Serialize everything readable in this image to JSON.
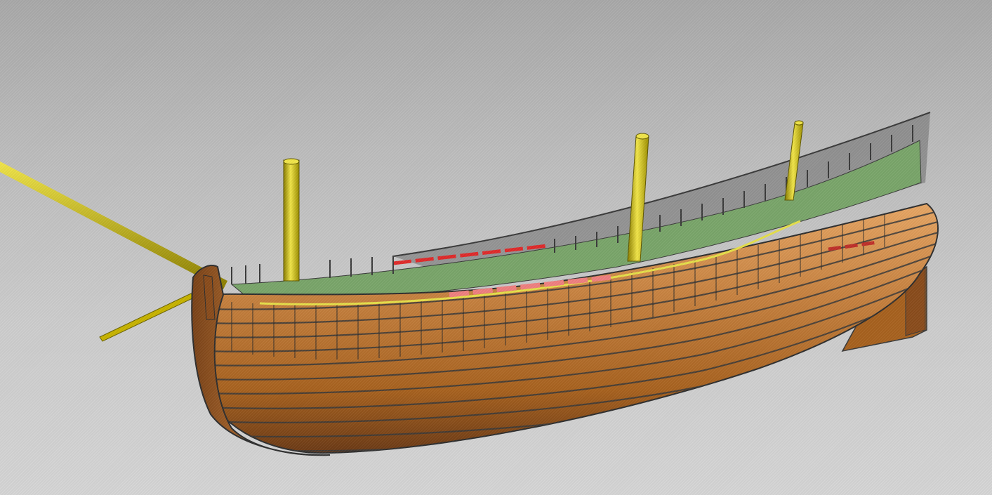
{
  "viewport": {
    "background_top": "#a9a9a9",
    "background_bottom": "#d6d6d6"
  },
  "model": {
    "hull_color": "#b87333",
    "hull_highlight": "#e8a765",
    "hull_shadow": "#6b3a16",
    "plank_line_color": "#3a3a3a",
    "mast_color": "#c8b400",
    "mast_highlight": "#f2e64a",
    "deck_green": "#7aa66a",
    "deck_red": "#e02a2a",
    "deck_pink": "#f08080",
    "railing_color": "#555555",
    "waterline_yellow": "#e6e04a"
  }
}
